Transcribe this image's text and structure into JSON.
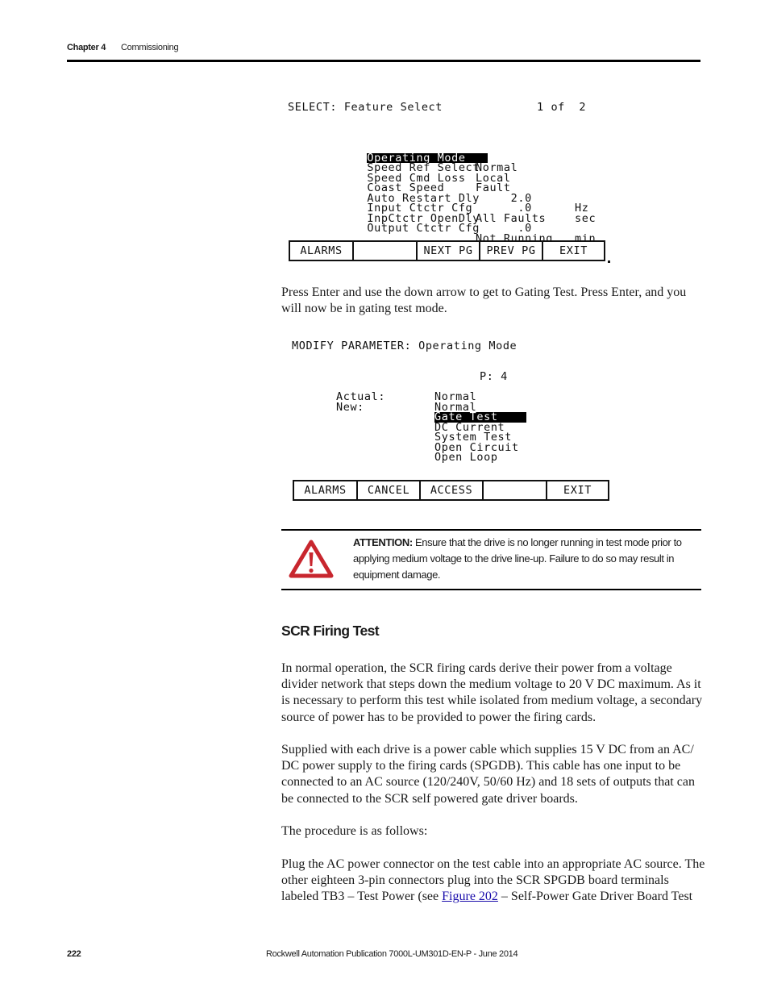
{
  "header": {
    "chapter": "Chapter 4",
    "section": "Commissioning"
  },
  "screen1": {
    "title": "SELECT: Feature Select",
    "page_indicator": "1 of  2",
    "rows": [
      {
        "label": "Operating Mode",
        "value": "Normal",
        "unit": "",
        "selected": true
      },
      {
        "label": "Speed Ref Select",
        "value": "Local",
        "unit": ""
      },
      {
        "label": "Speed Cmd Loss",
        "value": "Fault",
        "unit": ""
      },
      {
        "label": "Coast Speed",
        "value": "     2.0",
        "unit": "Hz"
      },
      {
        "label": "Auto Restart Dly",
        "value": "      .0",
        "unit": "sec"
      },
      {
        "label": "Input Ctctr Cfg",
        "value": "All Faults",
        "unit": ""
      },
      {
        "label": "InpCtctr OpenDly",
        "value": "      .0",
        "unit": "min"
      },
      {
        "label": "Output Ctctr Cfg",
        "value": "Not Running",
        "unit": ""
      }
    ],
    "buttons": [
      "ALARMS",
      "",
      "NEXT PG",
      "PREV PG",
      "EXIT"
    ]
  },
  "para_press_enter": "Press Enter and use the down arrow to get to Gating Test. Press Enter, and you will now be in gating test mode.",
  "screen2": {
    "title": "MODIFY PARAMETER: Operating Mode",
    "param_number": "P: 4",
    "actual_label": "Actual:",
    "new_label": "New:",
    "actual_value": "Normal",
    "new_value": "Normal",
    "options": [
      {
        "label": "Gate Test",
        "selected": true
      },
      {
        "label": "DC Current"
      },
      {
        "label": "System Test"
      },
      {
        "label": "Open Circuit"
      },
      {
        "label": "Open Loop"
      }
    ],
    "buttons": [
      "ALARMS",
      "CANCEL",
      "ACCESS",
      "",
      "EXIT"
    ]
  },
  "attention": {
    "icon": "warning-triangle-icon",
    "color": "#c8262e",
    "label": "ATTENTION:",
    "text": " Ensure that the drive is no longer running in test mode prior to applying medium voltage to the drive line-up. Failure to do so may result in equipment damage."
  },
  "section": {
    "heading": "SCR Firing Test",
    "para1": "In normal operation, the SCR firing cards derive their power from a voltage divider network that steps down the medium voltage to 20 V DC maximum. As it is necessary to perform this test while isolated from medium voltage, a secondary source of power has to be provided to power the firing cards.",
    "para2": "Supplied with each drive is a power cable which supplies 15 V DC from an AC/ DC power supply to the firing cards (SPGDB). This cable has one input to be connected to an AC source (120/240V, 50/60 Hz) and 18 sets of outputs that can be connected to the SCR self powered gate driver boards.",
    "para3": "The procedure is as follows:",
    "para4_before": "Plug the AC power connector on the test cable into an appropriate AC source. The other eighteen 3-pin connectors plug into the SCR SPGDB board terminals labeled TB3 – Test Power (see ",
    "para4_link": "Figure 202",
    "para4_after": " – Self-Power Gate Driver Board Test"
  },
  "footer": {
    "page_number": "222",
    "publication": "Rockwell Automation Publication 7000L-UM301D-EN-P - June 2014"
  }
}
